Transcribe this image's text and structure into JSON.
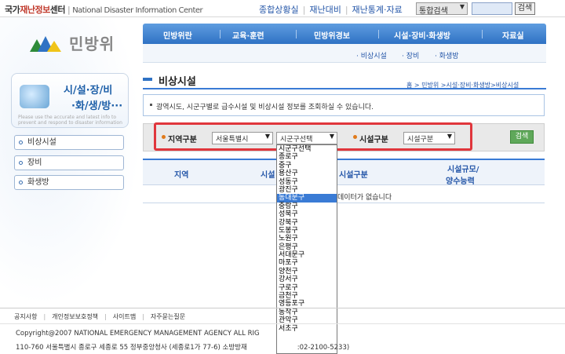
{
  "header": {
    "brand_part1": "국가",
    "brand_part2": "재난정보",
    "brand_part3": "센터",
    "brand_en": "National Disaster Information Center",
    "links": [
      "종합상황실",
      "재난대비",
      "재난통계·자료"
    ],
    "search_select": "통합검색",
    "search_button": "검색"
  },
  "logo": {
    "text": "민방위"
  },
  "sidebar": {
    "title_line1": "시/설·장/비",
    "title_line2": "·화/생/방···",
    "subtitle": "Please use the accurate and latest info to prevent and respond to disaster information",
    "items": [
      {
        "label": "비상시설"
      },
      {
        "label": "장비"
      },
      {
        "label": "화생방"
      }
    ]
  },
  "nav": {
    "items": [
      "민방위란",
      "교육·훈련",
      "민방위경보",
      "시설·장비·화생방",
      "자료실"
    ],
    "sub_items": [
      "· 비상시설",
      "· 장비",
      "· 화생방"
    ]
  },
  "page": {
    "title": "비상시설",
    "breadcrumb": "홈 > 민방위 >시설·장비·화생방>비상시설",
    "info": "광역시도, 시군구별로 급수시설 및 비상시설 정보를 조회하실 수 있습니다."
  },
  "search": {
    "region_label": "지역구분",
    "region_value": "서울특별시",
    "district_value": "시군구선택",
    "facility_label": "시설구분",
    "facility_value": "시설구분",
    "button": "검색"
  },
  "table": {
    "headers": [
      "지역",
      "시설",
      "시설구분",
      "시설규모/",
      "양수능력"
    ],
    "empty_message": "데이터가 없습니다"
  },
  "dropdown": {
    "selected_index": 7,
    "options": [
      "시군구선택",
      "종로구",
      "중구",
      "용산구",
      "성동구",
      "광진구",
      "동대문구",
      "중랑구",
      "성북구",
      "강북구",
      "도봉구",
      "노원구",
      "은평구",
      "서대문구",
      "마포구",
      "양천구",
      "강서구",
      "구로구",
      "금천구",
      "영등포구",
      "동작구",
      "관악구",
      "서초구"
    ]
  },
  "footer": {
    "links": [
      "공지사항",
      "개인정보보호정책",
      "사이트맵",
      "자주묻는질문"
    ],
    "copyright": "Copyright@2007 NATIONAL EMERGENCY MANAGEMENT AGENCY ALL RIG",
    "address": "110-760 서울특별시 종로구 세종로 55 정부중앙청사 (세종로1가 77-6) 소방방재",
    "phone_tail": ":02-2100-5233)"
  },
  "colors": {
    "nav_blue": "#2f72c4",
    "highlight_red": "#e0363c",
    "search_green": "#5fa85a",
    "link_blue": "#2456a8"
  }
}
